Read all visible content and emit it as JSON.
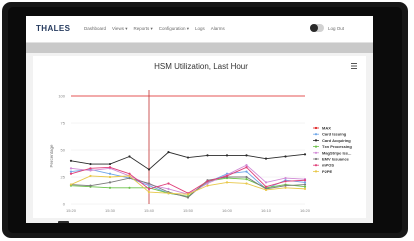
{
  "app": {
    "logo": "THALES",
    "nav": [
      "Dashboard",
      "Views ▾",
      "Reports ▾",
      "Configuration ▾",
      "Logs",
      "Alarms"
    ],
    "logout": "Log Out"
  },
  "icons": {
    "menu": "hamburger-menu-icon",
    "back": "arrow-left-icon",
    "toggle": "toggle-switch-icon"
  },
  "chart_data": {
    "type": "line",
    "title": "HSM Utilization, Last Hour",
    "ylabel": "Percentage",
    "xlabel": "",
    "x": [
      "15:20",
      "15:25",
      "15:30",
      "15:35",
      "15:40",
      "15:45",
      "15:50",
      "15:55",
      "16:00",
      "16:05",
      "16:10",
      "16:15",
      "16:20"
    ],
    "xticks": [
      "15:20",
      "15:30",
      "15:40",
      "15:50",
      "16:00",
      "16:10",
      "16:20"
    ],
    "yticks": [
      0,
      25,
      50,
      75,
      100
    ],
    "ylim": [
      0,
      100
    ],
    "max_line": 100,
    "marker_x": "15:40",
    "legend_position": "right",
    "grid": true,
    "series": [
      {
        "name": "MAX",
        "color": "#e02020",
        "values": []
      },
      {
        "name": "Card Issuing",
        "color": "#6ea6e8",
        "values": [
          30,
          32,
          28,
          24,
          17,
          10,
          7,
          20,
          28,
          30,
          14,
          22,
          20
        ]
      },
      {
        "name": "Card Acquiring",
        "color": "#2b2b2b",
        "values": [
          40,
          37,
          37,
          44,
          32,
          48,
          43,
          45,
          45,
          45,
          42,
          44,
          46
        ]
      },
      {
        "name": "Txn Processing",
        "color": "#6cc24a",
        "values": [
          17,
          16,
          15,
          15,
          15,
          10,
          7,
          21,
          24,
          23,
          15,
          18,
          16
        ]
      },
      {
        "name": "MagStripe Iss...",
        "color": "#d18ad6",
        "values": [
          33,
          31,
          33,
          26,
          18,
          14,
          9,
          19,
          27,
          36,
          20,
          24,
          23
        ]
      },
      {
        "name": "EMV Issuance",
        "color": "#7a7a7a",
        "values": [
          18,
          17,
          20,
          24,
          19,
          11,
          6,
          22,
          25,
          25,
          14,
          17,
          18
        ]
      },
      {
        "name": "mPOS",
        "color": "#e0407a",
        "values": [
          28,
          33,
          34,
          28,
          14,
          19,
          10,
          21,
          26,
          34,
          16,
          21,
          22
        ]
      },
      {
        "name": "P2PE",
        "color": "#e8c84a",
        "values": [
          18,
          26,
          25,
          26,
          11,
          10,
          9,
          17,
          20,
          19,
          13,
          15,
          14
        ]
      }
    ]
  }
}
